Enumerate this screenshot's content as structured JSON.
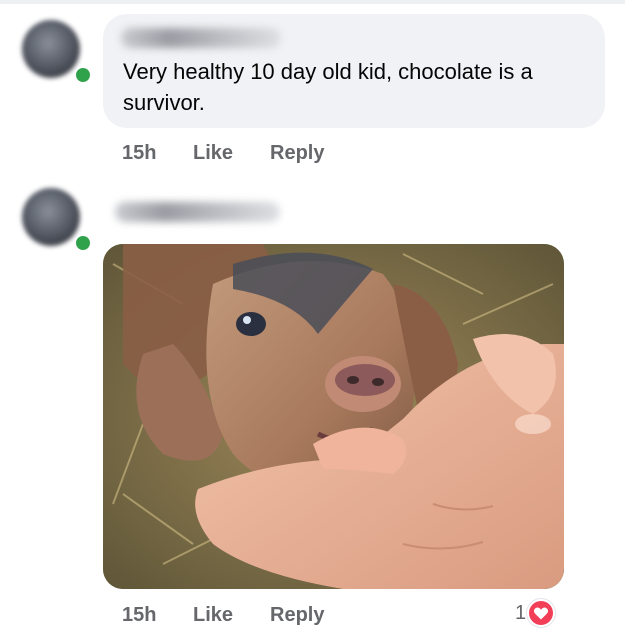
{
  "comments": [
    {
      "text": "Very healthy 10 day old kid, chocolate is a survivor.",
      "time": "15h",
      "like_label": "Like",
      "reply_label": "Reply"
    },
    {
      "time": "15h",
      "like_label": "Like",
      "reply_label": "Reply",
      "reaction_count": "1",
      "reaction_icon": "heart-icon"
    }
  ],
  "colors": {
    "bubble": "#f0f2f5",
    "meta_text": "#65676b",
    "online": "#31a24c",
    "love_reaction": "#f33e58"
  }
}
